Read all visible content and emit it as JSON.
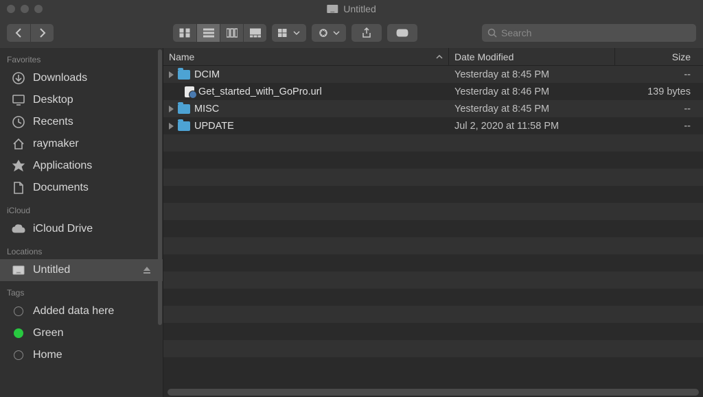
{
  "window": {
    "title": "Untitled"
  },
  "toolbar": {
    "search_placeholder": "Search"
  },
  "sidebar": {
    "favorites": [
      {
        "icon": "download-icon",
        "label": "Downloads"
      },
      {
        "icon": "desktop-icon",
        "label": "Desktop"
      },
      {
        "icon": "recents-icon",
        "label": "Recents"
      },
      {
        "icon": "house-icon",
        "label": "raymaker"
      },
      {
        "icon": "applications-icon",
        "label": "Applications"
      },
      {
        "icon": "documents-icon",
        "label": "Documents"
      }
    ],
    "icloud_header": "iCloud",
    "icloud": [
      {
        "icon": "cloud-icon",
        "label": "iCloud Drive"
      }
    ],
    "locations_header": "Locations",
    "locations": [
      {
        "icon": "disk-icon",
        "label": "Untitled",
        "selected": true,
        "eject": true
      }
    ],
    "tags_header": "Tags",
    "tags": [
      {
        "label": "Added data here",
        "color": null
      },
      {
        "label": "Green",
        "color": "green"
      },
      {
        "label": "Home",
        "color": null
      }
    ]
  },
  "columns": {
    "name": "Name",
    "date": "Date Modified",
    "size": "Size"
  },
  "files": [
    {
      "type": "folder",
      "name": "DCIM",
      "date": "Yesterday at 8:45 PM",
      "size": "--"
    },
    {
      "type": "url",
      "name": "Get_started_with_GoPro.url",
      "date": "Yesterday at 8:46 PM",
      "size": "139 bytes"
    },
    {
      "type": "folder",
      "name": "MISC",
      "date": "Yesterday at 8:45 PM",
      "size": "--"
    },
    {
      "type": "folder",
      "name": "UPDATE",
      "date": "Jul 2, 2020 at 11:58 PM",
      "size": "--"
    }
  ]
}
